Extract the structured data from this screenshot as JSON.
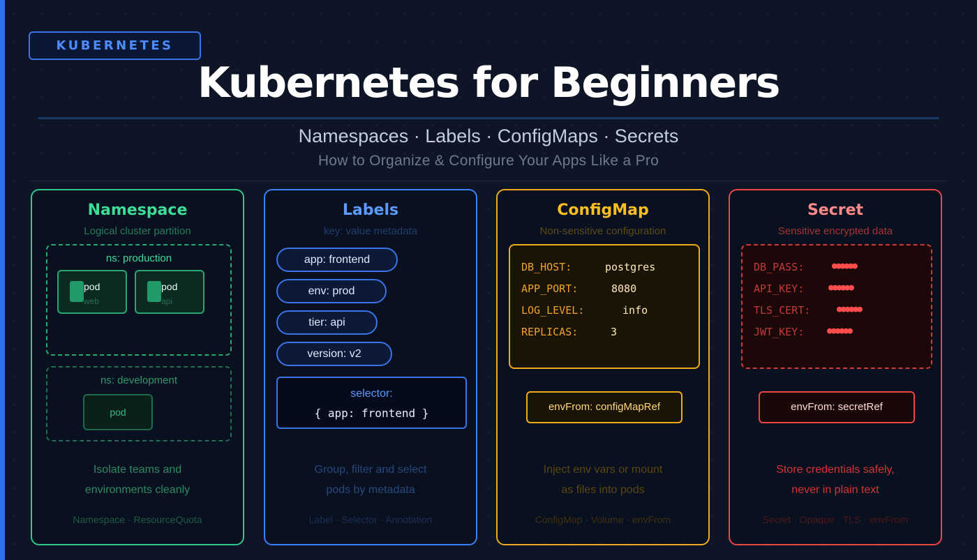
{
  "header": {
    "tag": "KUBERNETES",
    "title": "Kubernetes for Beginners",
    "subtitle": "Namespaces · Labels · ConfigMaps · Secrets",
    "tagline": "How to Organize & Configure Your Apps Like a Pro"
  },
  "colors": {
    "namespace": "#3ddc97",
    "labels": "#3b82f6",
    "configmap": "#fbbf24",
    "secret": "#ef4444",
    "background": "#0d1526"
  },
  "panels": {
    "namespace": {
      "title": "Namespace",
      "subtitle": "Logical cluster partition",
      "production": {
        "label": "ns: production",
        "pods": [
          {
            "name": "pod",
            "sub": "web"
          },
          {
            "name": "pod",
            "sub": "api"
          }
        ]
      },
      "development": {
        "label": "ns: development",
        "pod": "pod"
      },
      "desc_line1": "Isolate teams and",
      "desc_line2": "environments cleanly",
      "footer": "Namespace · ResourceQuota"
    },
    "labels": {
      "title": "Labels",
      "subtitle": "key: value metadata",
      "pills": [
        "app: frontend",
        "env: prod",
        "tier: api",
        "version: v2"
      ],
      "selector_label": "selector:",
      "selector_code": "{ app: frontend }",
      "desc_line1": "Group, filter and select",
      "desc_line2": "pods by metadata",
      "footer": "Label · Selector · Annotation"
    },
    "configmap": {
      "title": "ConfigMap",
      "subtitle": "Non-sensitive configuration",
      "entries": [
        {
          "key": "DB_HOST:",
          "value": "postgres"
        },
        {
          "key": "APP_PORT:",
          "value": "8080"
        },
        {
          "key": "LOG_LEVEL:",
          "value": "info"
        },
        {
          "key": "REPLICAS:",
          "value": "3"
        }
      ],
      "env": "envFrom: configMapRef",
      "desc_line1": "Inject env vars or mount",
      "desc_line2": "as files into pods",
      "footer": "ConfigMap · Volume · envFrom"
    },
    "secret": {
      "title": "Secret",
      "subtitle": "Sensitive encrypted data",
      "entries": [
        {
          "key": "DB_PASS:",
          "value": "●●●●●●"
        },
        {
          "key": "API_KEY:",
          "value": "●●●●●●"
        },
        {
          "key": "TLS_CERT:",
          "value": "●●●●●●"
        },
        {
          "key": "JWT_KEY:",
          "value": "●●●●●●"
        }
      ],
      "env": "envFrom: secretRef",
      "desc_line1": "Store credentials safely,",
      "desc_line2": "never in plain text",
      "footer": "Secret · Opaque · TLS · envFrom"
    }
  }
}
